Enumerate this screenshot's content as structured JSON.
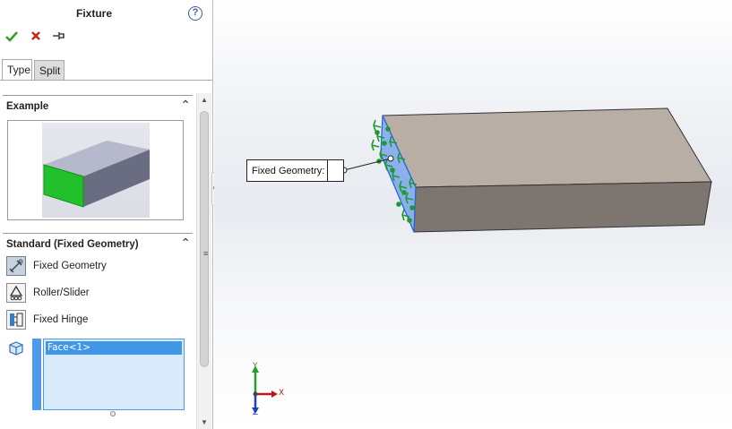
{
  "panel": {
    "title": "Fixture",
    "help_icon": "question-circle-icon",
    "toolbar": {
      "ok_icon": "checkmark-icon",
      "cancel_icon": "x-icon",
      "pin_icon": "pushpin-icon"
    },
    "tabs": [
      {
        "label": "Type",
        "active": true
      },
      {
        "label": "Split",
        "active": false
      }
    ],
    "example_section": {
      "title": "Example"
    },
    "standard_section": {
      "title": "Standard (Fixed Geometry)",
      "options": [
        {
          "label": "Fixed Geometry",
          "icon": "fixed-geometry-icon",
          "selected": true
        },
        {
          "label": "Roller/Slider",
          "icon": "roller-slider-icon",
          "selected": false
        },
        {
          "label": "Fixed Hinge",
          "icon": "fixed-hinge-icon",
          "selected": false
        }
      ],
      "selection_icon": "face-cube-icon",
      "selection_items": [
        "Face<1>"
      ]
    }
  },
  "viewport": {
    "callout_label": "Fixed Geometry:",
    "triad": {
      "x": "X",
      "y": "Y",
      "z": "Z"
    }
  },
  "colors": {
    "accent": "#3f97e6",
    "ok": "#3b9c2f",
    "cancel": "#c8231f",
    "fixture_arrows": "#1d9a2c",
    "face_highlight": "#3d7ee6",
    "box_top": "#b9aea6",
    "box_front": "#7d7570"
  }
}
